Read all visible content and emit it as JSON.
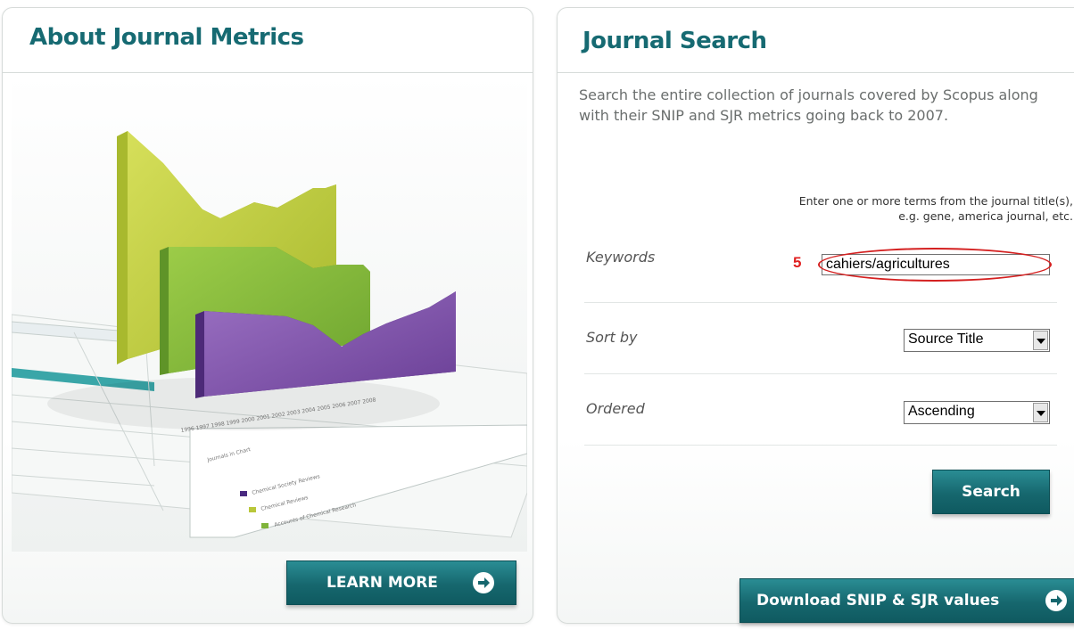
{
  "left_panel": {
    "title": "About Journal Metrics",
    "learn_more_label": "LEARN MORE",
    "chart_image": {
      "years": [
        "1996",
        "1997",
        "1998",
        "1999",
        "2000",
        "2001",
        "2002",
        "2003",
        "2004",
        "2005",
        "2006",
        "2007",
        "2008"
      ],
      "legend_heading": "Journals in Chart",
      "legend_items": [
        "Chemical Society Reviews",
        "Chemical Reviews",
        "Accounts of Chemical Research"
      ],
      "colors": {
        "yellow_green": "#b9c73a",
        "green": "#7fb33a",
        "purple": "#7b4fa3"
      }
    }
  },
  "right_panel": {
    "title": "Journal Search",
    "description": "Search the entire collection of journals covered by Scopus along with their SNIP and SJR metrics going back to 2007.",
    "hint_line1": "Enter one or more terms from the journal title(s),",
    "hint_line2": "e.g. gene, america journal, etc.",
    "keywords_label": "Keywords",
    "keywords_value": "cahiers/agricultures",
    "annotation_number": "5",
    "sort_label": "Sort by",
    "sort_value": "Source Title",
    "ordered_label": "Ordered",
    "ordered_value": "Ascending",
    "search_label": "Search",
    "download_label": "Download SNIP & SJR values"
  },
  "colors": {
    "brand_teal": "#166a72",
    "button_teal": "#16676e",
    "annotation_red": "#d42020"
  }
}
